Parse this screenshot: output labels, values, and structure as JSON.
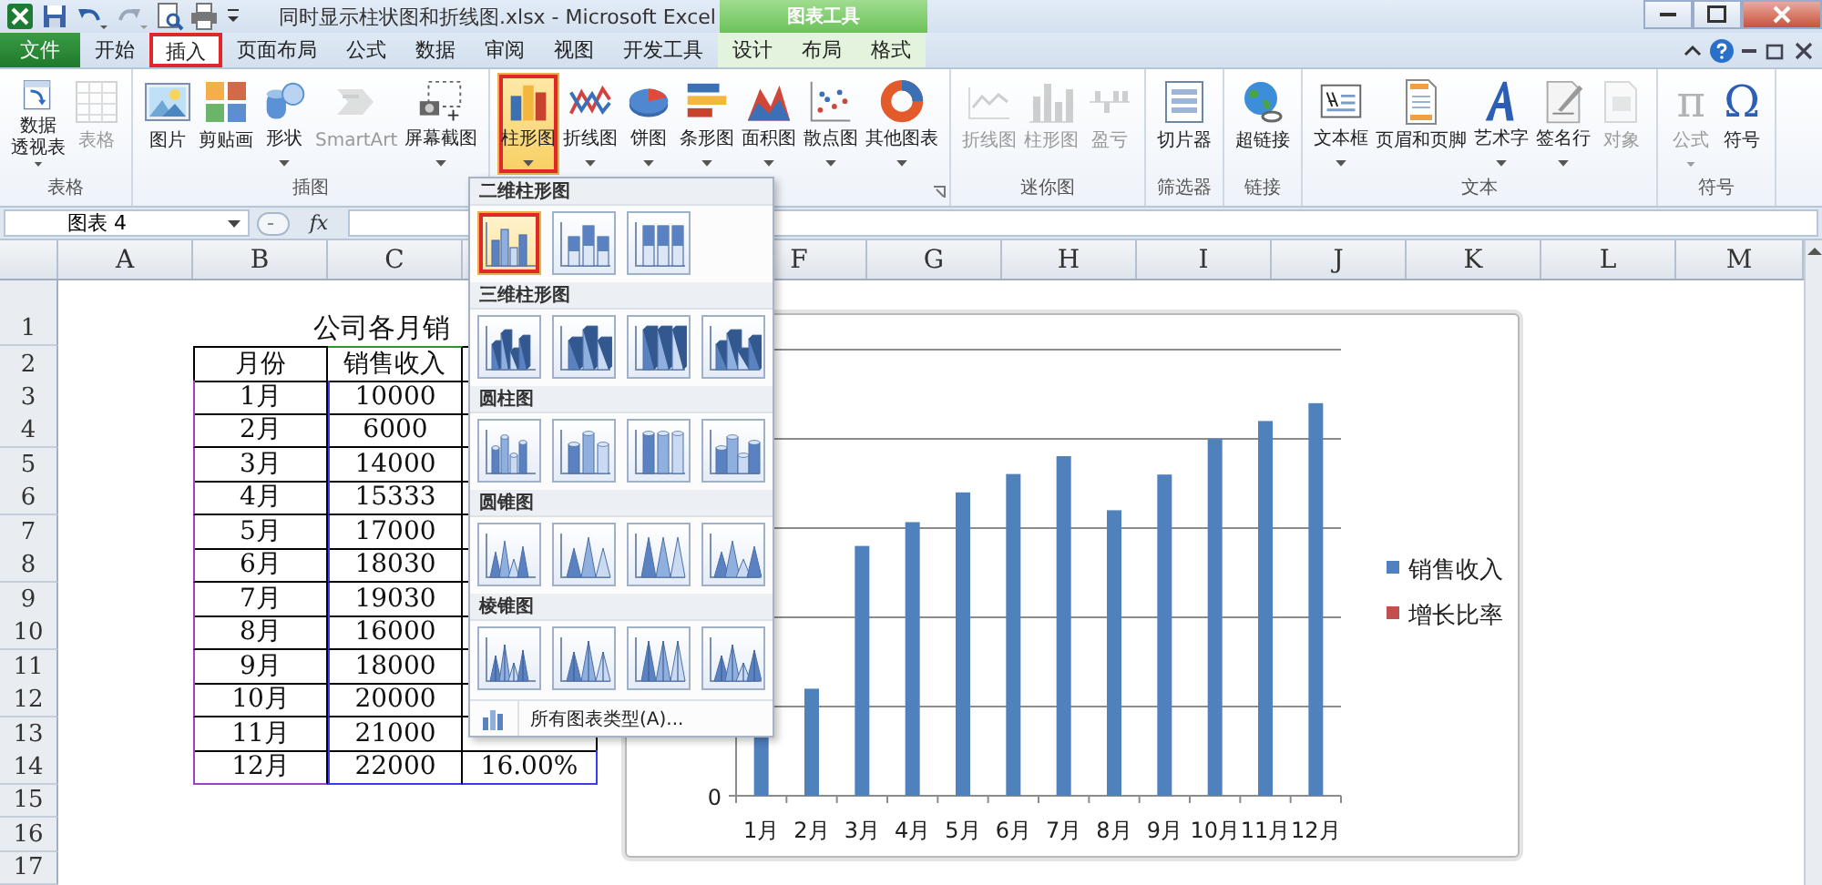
{
  "window": {
    "title": "同时显示柱状图和折线图.xlsx - Microsoft Excel",
    "context_group": "图表工具"
  },
  "quick_access": [
    {
      "kind": "excel"
    },
    {
      "kind": "save"
    },
    {
      "kind": "undo"
    },
    {
      "kind": "redo"
    },
    {
      "kind": "preview"
    },
    {
      "kind": "print"
    },
    {
      "kind": "customize"
    }
  ],
  "tabs": [
    {
      "label": "文件",
      "kind": "file",
      "selected": false,
      "highlighted": false
    },
    {
      "label": "开始",
      "kind": "normal",
      "selected": false,
      "highlighted": false
    },
    {
      "label": "插入",
      "kind": "normal",
      "selected": true,
      "highlighted": true
    },
    {
      "label": "页面布局",
      "kind": "normal",
      "selected": false,
      "highlighted": false
    },
    {
      "label": "公式",
      "kind": "normal",
      "selected": false,
      "highlighted": false
    },
    {
      "label": "数据",
      "kind": "normal",
      "selected": false,
      "highlighted": false
    },
    {
      "label": "审阅",
      "kind": "normal",
      "selected": false,
      "highlighted": false
    },
    {
      "label": "视图",
      "kind": "normal",
      "selected": false,
      "highlighted": false
    },
    {
      "label": "开发工具",
      "kind": "normal",
      "selected": false,
      "highlighted": false
    },
    {
      "label": "设计",
      "kind": "context",
      "selected": false,
      "highlighted": false
    },
    {
      "label": "布局",
      "kind": "context",
      "selected": false,
      "highlighted": false
    },
    {
      "label": "格式",
      "kind": "context",
      "selected": false,
      "highlighted": false
    }
  ],
  "ribbon": {
    "groups": [
      {
        "label": "表格",
        "launcher": false,
        "buttons": [
          {
            "kind": "pivot",
            "lines": [
              "数据",
              "透视表"
            ],
            "dropdown": true,
            "disabled": false,
            "pressed": false,
            "highlighted": false
          },
          {
            "kind": "table",
            "label": "表格",
            "dropdown": false,
            "disabled": true,
            "pressed": false,
            "highlighted": false
          }
        ]
      },
      {
        "label": "插图",
        "launcher": false,
        "buttons": [
          {
            "kind": "picture",
            "label": "图片",
            "dropdown": false,
            "disabled": false,
            "pressed": false,
            "highlighted": false
          },
          {
            "kind": "clipart",
            "label": "剪贴画",
            "dropdown": false,
            "disabled": false,
            "pressed": false,
            "highlighted": false
          },
          {
            "kind": "shapes",
            "label": "形状",
            "dropdown": true,
            "disabled": false,
            "pressed": false,
            "highlighted": false
          },
          {
            "kind": "smartart",
            "label": "SmartArt",
            "dropdown": false,
            "disabled": true,
            "pressed": false,
            "highlighted": false
          },
          {
            "kind": "screenshot",
            "label": "屏幕截图",
            "dropdown": true,
            "disabled": false,
            "pressed": false,
            "highlighted": false
          }
        ]
      },
      {
        "launcher": true,
        "buttons": [
          {
            "kind": "column",
            "label": "柱形图",
            "dropdown": true,
            "disabled": false,
            "pressed": true,
            "highlighted": true
          },
          {
            "kind": "line",
            "label": "折线图",
            "dropdown": true,
            "disabled": false,
            "pressed": false,
            "highlighted": false
          },
          {
            "kind": "pie",
            "label": "饼图",
            "dropdown": true,
            "disabled": false,
            "pressed": false,
            "highlighted": false
          },
          {
            "kind": "bar",
            "label": "条形图",
            "dropdown": true,
            "disabled": false,
            "pressed": false,
            "highlighted": false
          },
          {
            "kind": "area",
            "label": "面积图",
            "dropdown": true,
            "disabled": false,
            "pressed": false,
            "highlighted": false
          },
          {
            "kind": "scatter",
            "label": "散点图",
            "dropdown": true,
            "disabled": false,
            "pressed": false,
            "highlighted": false
          },
          {
            "kind": "other",
            "label": "其他图表",
            "dropdown": true,
            "disabled": false,
            "pressed": false,
            "highlighted": false
          }
        ]
      },
      {
        "label": "迷你图",
        "launcher": false,
        "buttons": [
          {
            "kind": "sparkline",
            "label": "折线图",
            "dropdown": false,
            "disabled": true,
            "pressed": false,
            "highlighted": false
          },
          {
            "kind": "sparkcolumn",
            "label": "柱形图",
            "dropdown": false,
            "disabled": true,
            "pressed": false,
            "highlighted": false
          },
          {
            "kind": "winloss",
            "label": "盈亏",
            "dropdown": false,
            "disabled": true,
            "pressed": false,
            "highlighted": false
          }
        ]
      },
      {
        "label": "筛选器",
        "launcher": false,
        "buttons": [
          {
            "kind": "slicer",
            "label": "切片器",
            "dropdown": false,
            "disabled": false,
            "pressed": false,
            "highlighted": false
          }
        ]
      },
      {
        "label": "链接",
        "launcher": false,
        "buttons": [
          {
            "kind": "hyperlink",
            "label": "超链接",
            "dropdown": false,
            "disabled": false,
            "pressed": false,
            "highlighted": false
          }
        ]
      },
      {
        "label": "文本",
        "launcher": false,
        "buttons": [
          {
            "kind": "textbox",
            "label": "文本框",
            "dropdown": true,
            "disabled": false,
            "pressed": false,
            "highlighted": false
          },
          {
            "kind": "header",
            "label": "页眉和页脚",
            "dropdown": false,
            "disabled": false,
            "pressed": false,
            "highlighted": false
          },
          {
            "kind": "wordart",
            "label": "艺术字",
            "dropdown": true,
            "disabled": false,
            "pressed": false,
            "highlighted": false
          },
          {
            "kind": "signature",
            "label": "签名行",
            "dropdown": true,
            "disabled": false,
            "pressed": false,
            "highlighted": false
          },
          {
            "kind": "object",
            "label": "对象",
            "dropdown": false,
            "disabled": true,
            "pressed": false,
            "highlighted": false
          }
        ]
      },
      {
        "label": "符号",
        "launcher": false,
        "buttons": [
          {
            "kind": "equation",
            "icon_text": "π",
            "label": "公式",
            "dropdown": true,
            "disabled": true,
            "pressed": false,
            "highlighted": false
          },
          {
            "kind": "symbol",
            "icon_text": "Ω",
            "label": "符号",
            "dropdown": false,
            "disabled": false,
            "pressed": false,
            "highlighted": false
          }
        ]
      }
    ]
  },
  "formula_bar": {
    "name_box": "图表 4",
    "function_label": "fx"
  },
  "sheet": {
    "column_headers": [
      "A",
      "B",
      "C",
      "F",
      "G",
      "H",
      "I",
      "J",
      "K",
      "L",
      "M"
    ],
    "row_headers": [
      "1",
      "2",
      "3",
      "4",
      "5",
      "6",
      "7",
      "8",
      "9",
      "10",
      "11",
      "12",
      "13",
      "14",
      "15",
      "16",
      "17"
    ],
    "table": {
      "title": "公司各月销",
      "header": [
        "月份",
        "销售收入"
      ],
      "ranges_shown": true,
      "rows": [
        {
          "month": "1月",
          "sales": "10000"
        },
        {
          "month": "2月",
          "sales": "6000"
        },
        {
          "month": "3月",
          "sales": "14000"
        },
        {
          "month": "4月",
          "sales": "15333"
        },
        {
          "month": "5月",
          "sales": "17000"
        },
        {
          "month": "6月",
          "sales": "18030"
        },
        {
          "month": "7月",
          "sales": "19030"
        },
        {
          "month": "8月",
          "sales": "16000"
        },
        {
          "month": "9月",
          "sales": "18000"
        },
        {
          "month": "10月",
          "sales": "20000"
        },
        {
          "month": "11月",
          "sales": "21000"
        },
        {
          "month": "12月",
          "sales": "22000",
          "growth": "16.00%"
        }
      ]
    }
  },
  "chart": {
    "y_tick": "0",
    "categories": [
      "1月",
      "2月",
      "3月",
      "4月",
      "5月",
      "6月",
      "7月",
      "8月",
      "9月",
      "10月",
      "11月",
      "12月"
    ],
    "legend": [
      {
        "label": "销售收入",
        "color": "#4f81bd"
      },
      {
        "label": "增长比率",
        "color": "#c0504d"
      }
    ]
  },
  "chart_gallery": {
    "sections": [
      {
        "title": "二维柱形图",
        "kind": "column2d",
        "options": [
          {
            "selected": true,
            "highlighted": true
          },
          {
            "selected": false,
            "highlighted": false
          },
          {
            "selected": false,
            "highlighted": false
          }
        ]
      },
      {
        "title": "三维柱形图",
        "kind": "column3d",
        "options": [
          {
            "selected": false,
            "highlighted": false
          },
          {
            "selected": false,
            "highlighted": false
          },
          {
            "selected": false,
            "highlighted": false
          },
          {
            "selected": false,
            "highlighted": false
          }
        ]
      },
      {
        "title": "圆柱图",
        "kind": "cylinder",
        "options": [
          {
            "selected": false,
            "highlighted": false
          },
          {
            "selected": false,
            "highlighted": false
          },
          {
            "selected": false,
            "highlighted": false
          },
          {
            "selected": false,
            "highlighted": false
          }
        ]
      },
      {
        "title": "圆锥图",
        "kind": "cone",
        "options": [
          {
            "selected": false,
            "highlighted": false
          },
          {
            "selected": false,
            "highlighted": false
          },
          {
            "selected": false,
            "highlighted": false
          },
          {
            "selected": false,
            "highlighted": false
          }
        ]
      },
      {
        "title": "棱锥图",
        "kind": "pyramid",
        "options": [
          {
            "selected": false,
            "highlighted": false
          },
          {
            "selected": false,
            "highlighted": false
          },
          {
            "selected": false,
            "highlighted": false
          },
          {
            "selected": false,
            "highlighted": false
          }
        ]
      }
    ],
    "footer": "所有图表类型(A)..."
  }
}
